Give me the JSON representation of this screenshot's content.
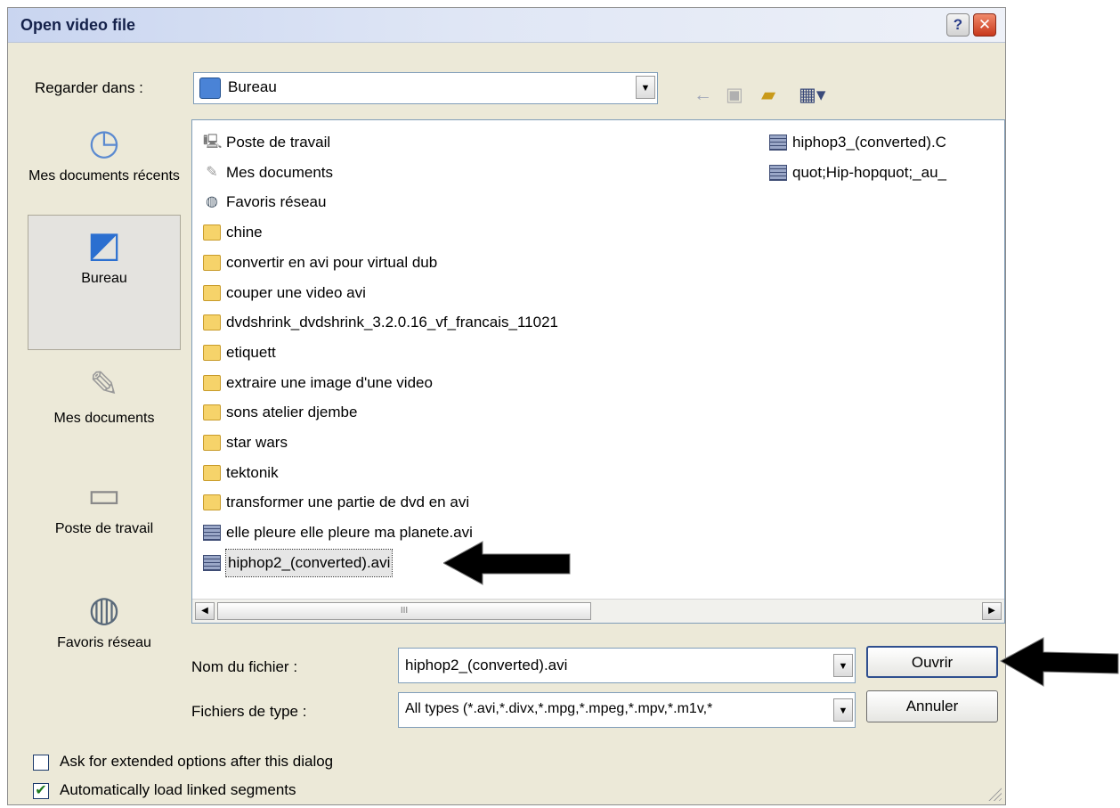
{
  "window": {
    "title": "Open video file",
    "help_label": "?",
    "close_label": "✕"
  },
  "toolbar": {
    "look_in_label": "Regarder dans :",
    "look_in_value": "Bureau"
  },
  "places": [
    {
      "label": "Mes documents récents",
      "icon": "recent-documents-icon"
    },
    {
      "label": "Bureau",
      "icon": "desktop-icon",
      "selected": true
    },
    {
      "label": "Mes documents",
      "icon": "my-documents-icon"
    },
    {
      "label": "Poste de travail",
      "icon": "my-computer-icon"
    },
    {
      "label": "Favoris réseau",
      "icon": "network-places-icon"
    }
  ],
  "files_col1": [
    {
      "name": "Poste de travail",
      "icon": "computer"
    },
    {
      "name": "Mes documents",
      "icon": "documents"
    },
    {
      "name": "Favoris réseau",
      "icon": "network"
    },
    {
      "name": "chine",
      "icon": "folder"
    },
    {
      "name": "convertir en avi pour virtual dub",
      "icon": "folder"
    },
    {
      "name": "couper une video avi",
      "icon": "folder"
    },
    {
      "name": "dvdshrink_dvdshrink_3.2.0.16_vf_francais_11021",
      "icon": "folder"
    },
    {
      "name": "etiquett",
      "icon": "folder"
    },
    {
      "name": "extraire une image d'une video",
      "icon": "folder"
    },
    {
      "name": "sons atelier djembe",
      "icon": "folder"
    },
    {
      "name": "star wars",
      "icon": "folder"
    },
    {
      "name": "tektonik",
      "icon": "folder"
    },
    {
      "name": "transformer une partie de dvd en avi",
      "icon": "folder"
    },
    {
      "name": "elle pleure elle pleure ma planete.avi",
      "icon": "video"
    },
    {
      "name": "hiphop2_(converted).avi",
      "icon": "video",
      "selected": true
    }
  ],
  "files_col2": [
    {
      "name": "hiphop3_(converted).C",
      "icon": "video"
    },
    {
      "name": "quot;Hip-hopquot;_au_",
      "icon": "video"
    }
  ],
  "scrollbar": {
    "thumb_grip": "III"
  },
  "form": {
    "filename_label": "Nom du fichier :",
    "filename_value": "hiphop2_(converted).avi",
    "filetype_label": "Fichiers de type :",
    "filetype_value": "All types (*.avi,*.divx,*.mpg,*.mpeg,*.mpv,*.m1v,*"
  },
  "buttons": {
    "open": "Ouvrir",
    "cancel": "Annuler"
  },
  "options": [
    {
      "label": "Ask for extended options after this dialog",
      "checked": false
    },
    {
      "label": "Automatically load linked segments",
      "checked": true
    }
  ],
  "colors": {
    "arrow": "#000000",
    "title_text": "#14214a",
    "selection": "#e6e6e6"
  }
}
